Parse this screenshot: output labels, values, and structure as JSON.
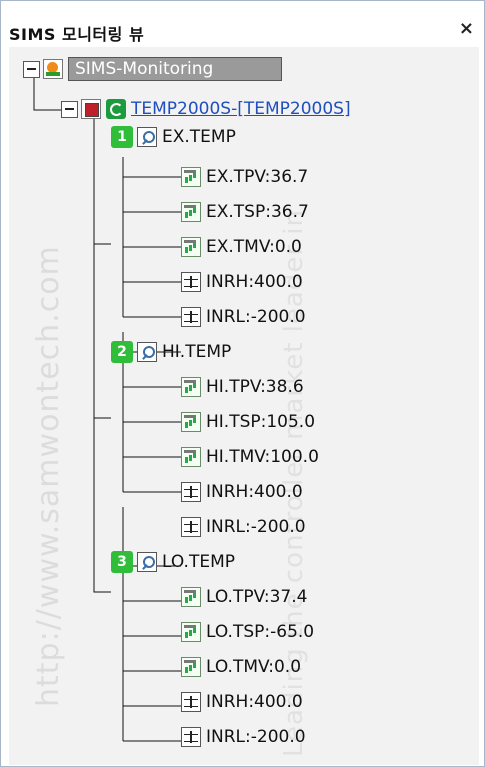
{
  "panel": {
    "title": "SIMS 모니터링 뷰",
    "close_glyph": "×"
  },
  "watermark": {
    "side": "http://www.samwontech.com",
    "mid": "Leading the controller market leader in"
  },
  "tree": {
    "root": {
      "label": "SIMS-Monitoring",
      "icon": "sims-icon"
    },
    "device": {
      "label": "TEMP2000S-[TEMP2000S]"
    },
    "groups": [
      {
        "badge": "1",
        "label": "EX.TEMP",
        "items": [
          {
            "label": "EX.TPV:36.7",
            "icon": "signal"
          },
          {
            "label": "EX.TSP:36.7",
            "icon": "signal"
          },
          {
            "label": "EX.TMV:0.0",
            "icon": "signal"
          },
          {
            "label": "INRH:400.0",
            "icon": "range"
          },
          {
            "label": "INRL:-200.0",
            "icon": "range"
          }
        ]
      },
      {
        "badge": "2",
        "label": "HI.TEMP",
        "items": [
          {
            "label": "HI.TPV:38.6",
            "icon": "signal"
          },
          {
            "label": "HI.TSP:105.0",
            "icon": "signal"
          },
          {
            "label": "HI.TMV:100.0",
            "icon": "signal"
          },
          {
            "label": "INRH:400.0",
            "icon": "range"
          },
          {
            "label": "INRL:-200.0",
            "icon": "range"
          }
        ]
      },
      {
        "badge": "3",
        "label": "LO.TEMP",
        "items": [
          {
            "label": "LO.TPV:37.4",
            "icon": "signal"
          },
          {
            "label": "LO.TSP:-65.0",
            "icon": "signal"
          },
          {
            "label": "LO.TMV:0.0",
            "icon": "signal"
          },
          {
            "label": "INRH:400.0",
            "icon": "range"
          },
          {
            "label": "INRL:-200.0",
            "icon": "range"
          }
        ]
      }
    ]
  }
}
